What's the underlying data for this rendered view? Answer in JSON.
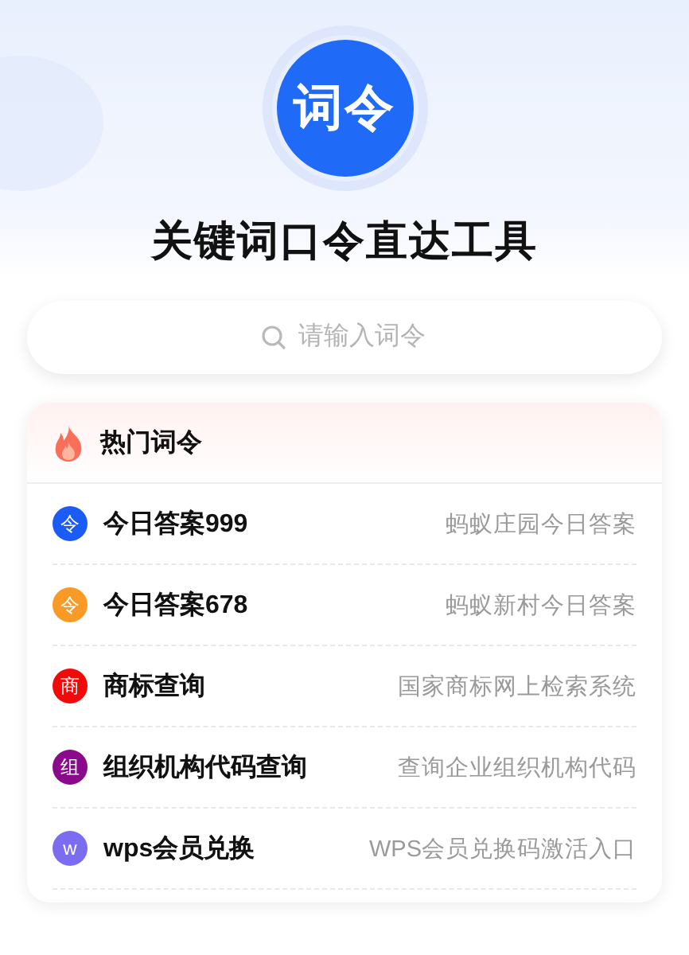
{
  "logo": {
    "text": "词令"
  },
  "title": "关键词口令直达工具",
  "search": {
    "placeholder": "请输入词令"
  },
  "hot": {
    "title": "热门词令",
    "items": [
      {
        "badge": "令",
        "color": "#1a5cf5",
        "name": "今日答案999",
        "desc": "蚂蚁庄园今日答案"
      },
      {
        "badge": "令",
        "color": "#fa9a26",
        "name": "今日答案678",
        "desc": "蚂蚁新村今日答案"
      },
      {
        "badge": "商",
        "color": "#f00a0a",
        "name": "商标查询",
        "desc": "国家商标网上检索系统"
      },
      {
        "badge": "组",
        "color": "#8a0a8c",
        "name": "组织机构代码查询",
        "desc": "查询企业组织机构代码"
      },
      {
        "badge": "w",
        "color": "#7b6cf0",
        "name": "wps会员兑换",
        "desc": "WPS会员兑换码激活入口"
      }
    ]
  }
}
